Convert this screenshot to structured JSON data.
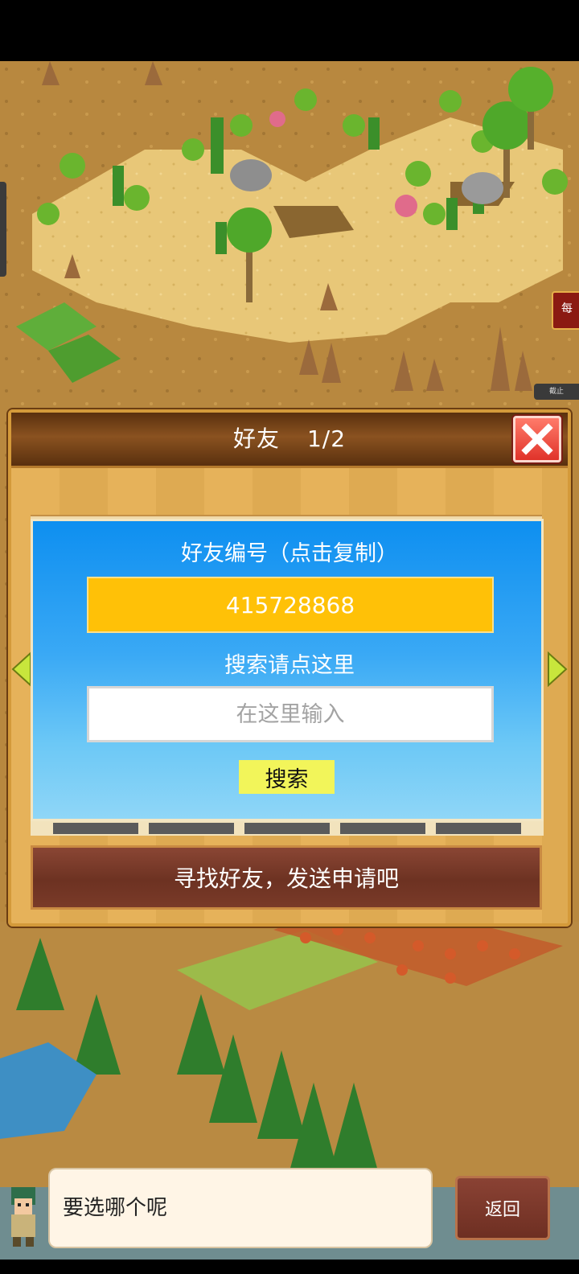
{
  "panel": {
    "title": "好友",
    "page": "1/2"
  },
  "card": {
    "id_label": "好友编号（点击复制）",
    "id_value": "415728868",
    "search_label": "搜索请点这里",
    "search_placeholder": "在这里输入",
    "search_button": "搜索"
  },
  "find_button": "寻找好友，发送申请吧",
  "dialog": {
    "message": "要选哪个呢"
  },
  "back_button": "返回",
  "side_badge": "每",
  "side_small_label": "截止",
  "colors": {
    "card_blue": "#1a96f2",
    "id_box": "#ffc107",
    "search_button": "#f2f55a",
    "close_button": "#e0332a",
    "find_bar": "#6d3222",
    "arrow": "#c8e63c"
  },
  "icons": {
    "close": "close-icon",
    "prev": "left-arrow-icon",
    "next": "right-arrow-icon",
    "avatar": "character-avatar-icon"
  }
}
